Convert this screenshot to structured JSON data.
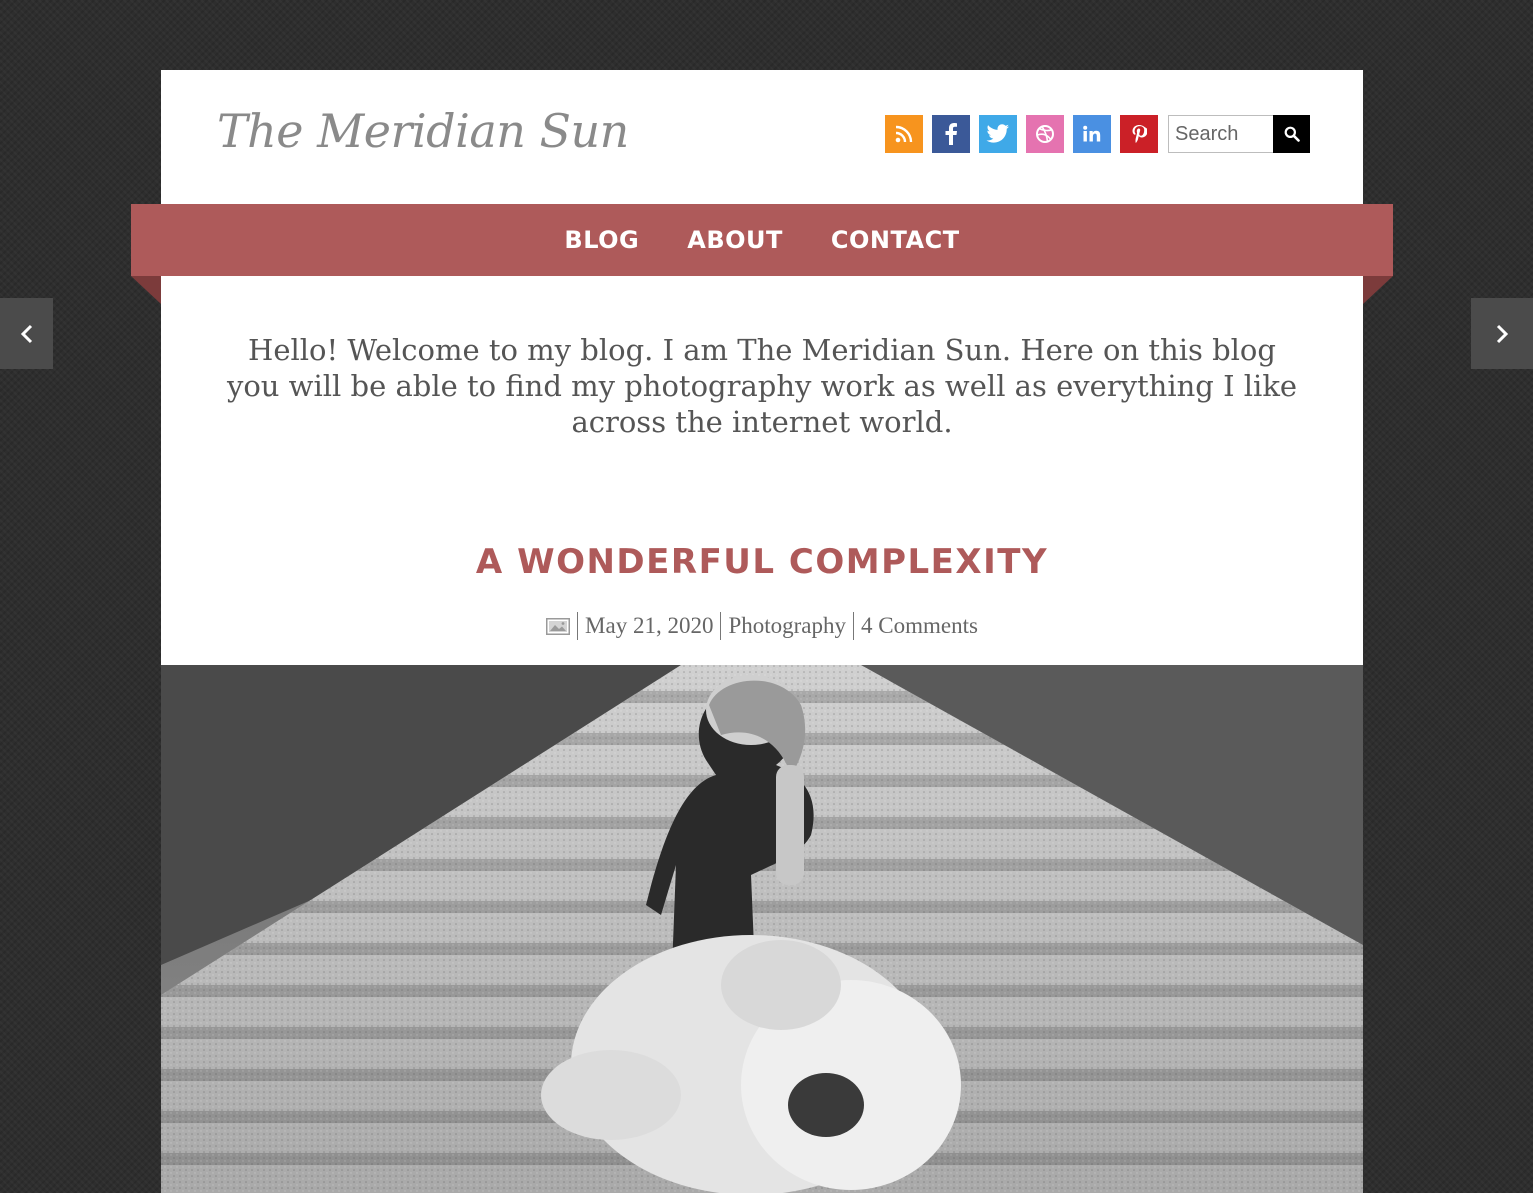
{
  "site": {
    "title": "The Meridian Sun"
  },
  "header": {
    "social_icons": [
      "rss-icon",
      "facebook-icon",
      "twitter-icon",
      "dribbble-icon",
      "linkedin-icon",
      "pinterest-icon"
    ],
    "social_colors": {
      "rss": "#f7941e",
      "facebook": "#3b5998",
      "twitter": "#3fa9e8",
      "dribbble": "#e573b0",
      "linkedin": "#4a90e2",
      "pinterest": "#cb2027"
    },
    "search": {
      "placeholder": "Search",
      "value": ""
    }
  },
  "nav": {
    "items": [
      {
        "label": "BLOG"
      },
      {
        "label": "ABOUT"
      },
      {
        "label": "CONTACT"
      }
    ],
    "color": "#ae5a5a"
  },
  "intro": {
    "text": "Hello! Welcome to my blog. I am The Meridian Sun. Here on this blog you will be able to find my photography work as well as everything I like across the internet world."
  },
  "post": {
    "title": "A WONDERFUL COMPLEXITY",
    "format_icon": "image-icon",
    "date": "May 21, 2020",
    "category": "Photography",
    "comments": "4 Comments",
    "image_icon": "photo-girl-with-teddy-bear"
  },
  "slider": {
    "prev_icon": "chevron-left-icon",
    "next_icon": "chevron-right-icon"
  }
}
